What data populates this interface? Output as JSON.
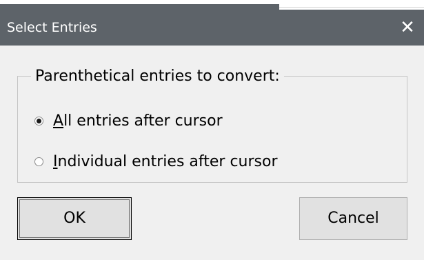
{
  "window": {
    "title": "Select Entries",
    "close_icon": "close-icon",
    "title_bar_color": "#5d6369"
  },
  "group": {
    "legend": "Parenthetical entries to convert:",
    "options": [
      {
        "mnemonic": "A",
        "rest": "ll entries after cursor",
        "checked": true
      },
      {
        "mnemonic": "I",
        "rest": "ndividual entries after cursor",
        "checked": false
      }
    ]
  },
  "buttons": {
    "ok_label": "OK",
    "cancel_label": "Cancel"
  }
}
